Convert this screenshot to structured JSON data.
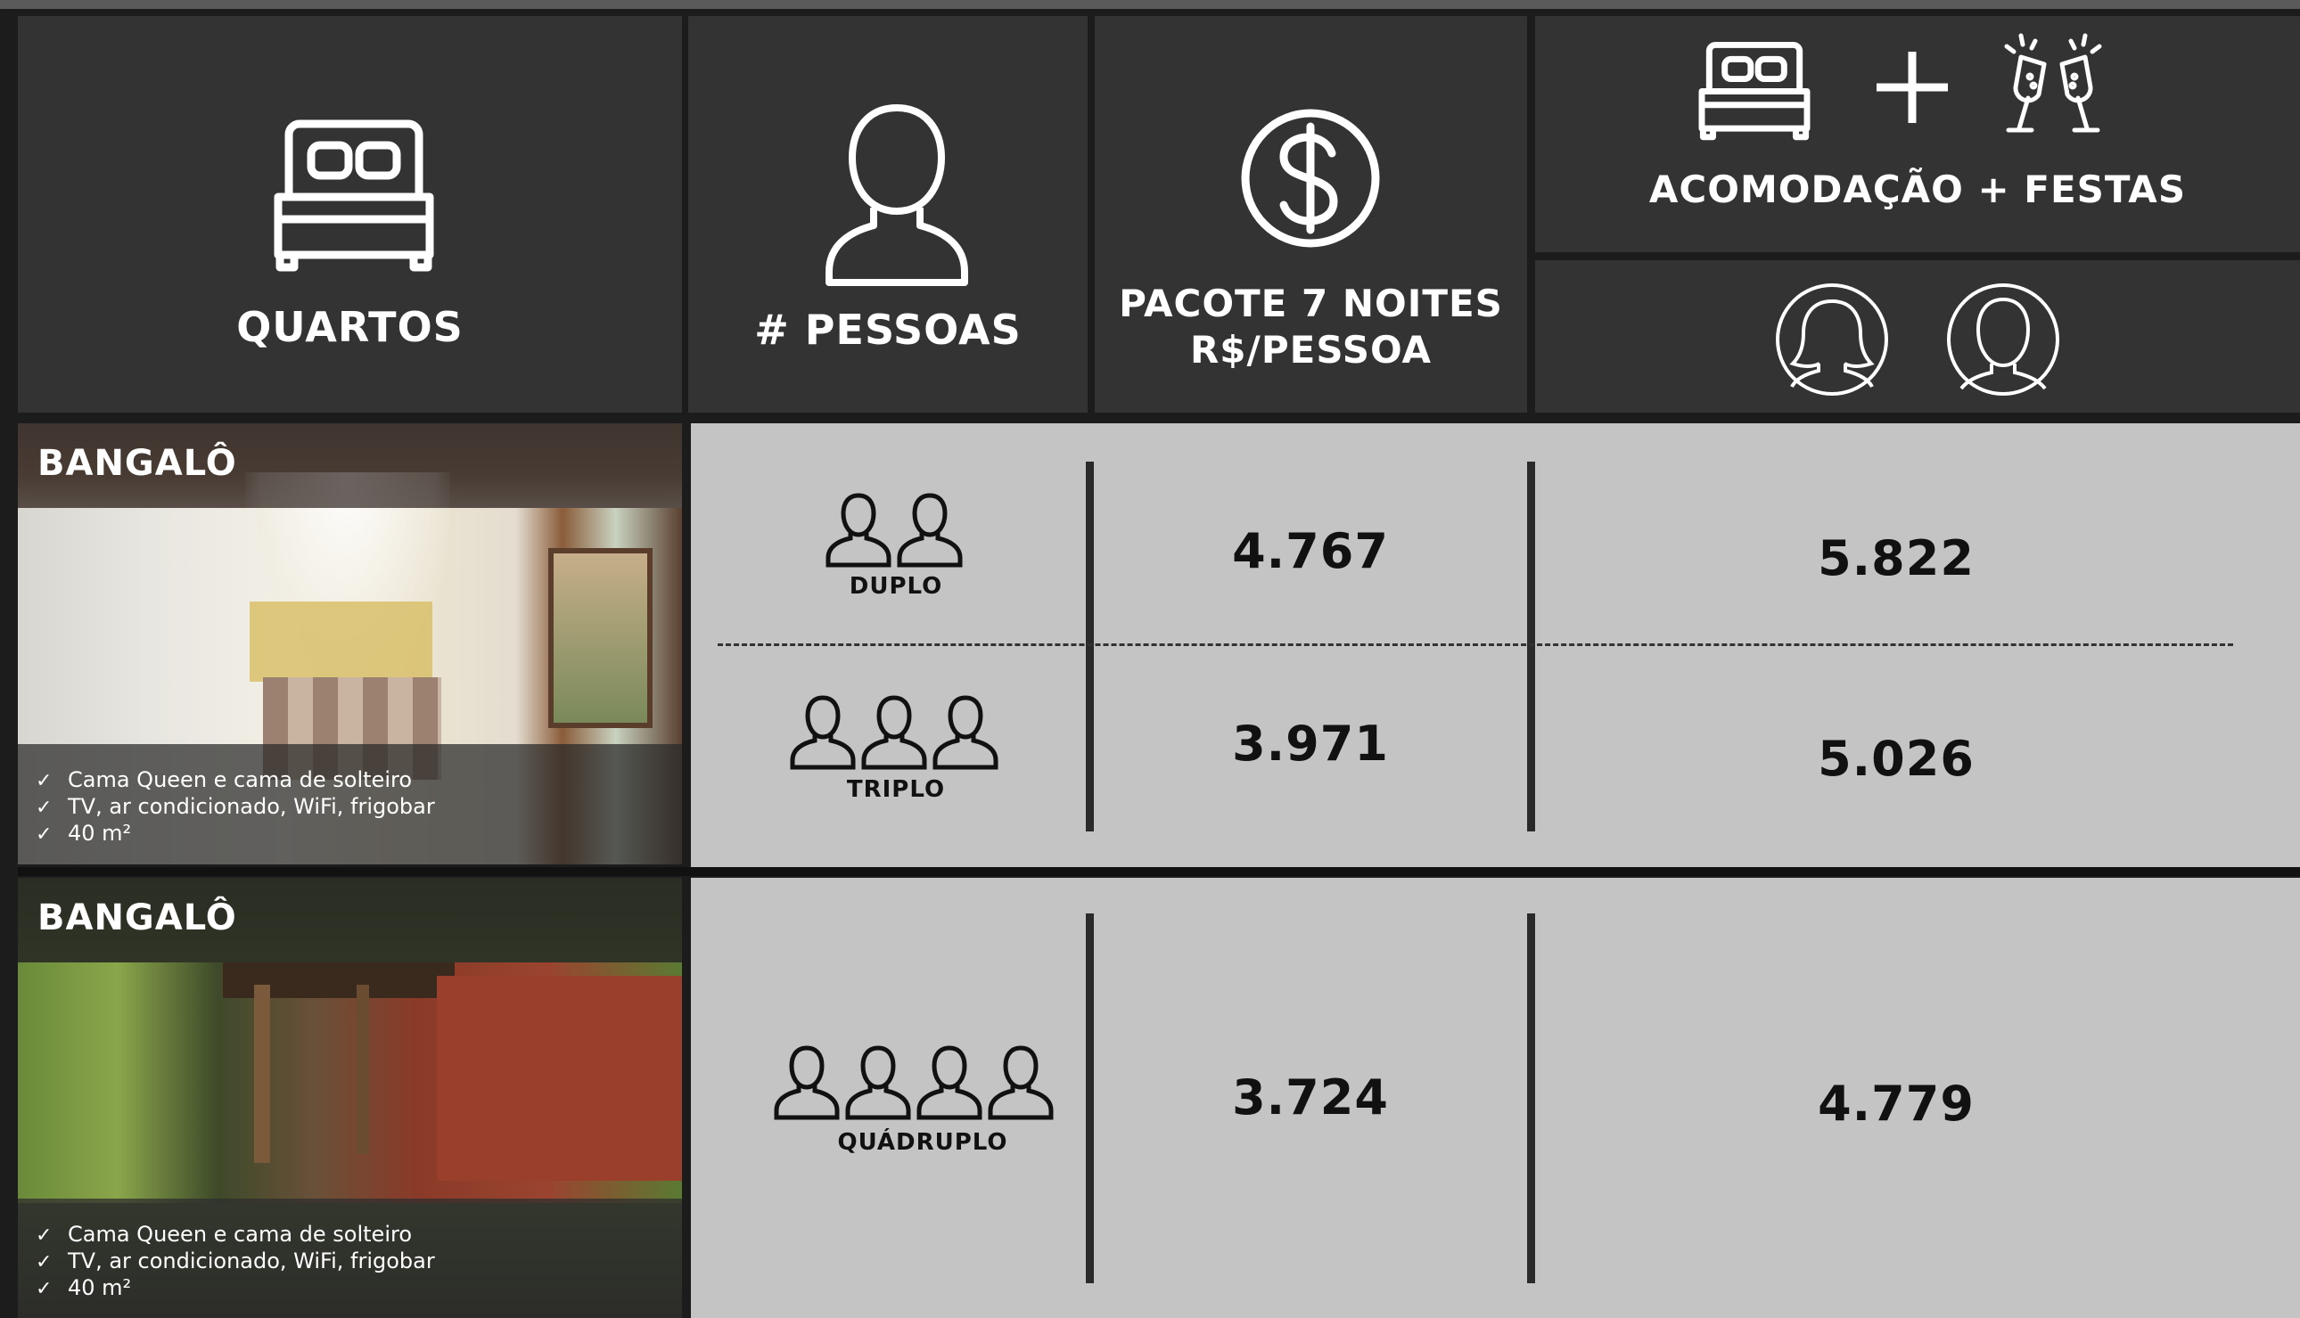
{
  "header": {
    "rooms_label": "QUARTOS",
    "people_label": "# PESSOAS",
    "package_label_line1": "PACOTE 7 NOITES",
    "package_label_line2": "R$/PESSOA",
    "combo_label": "ACOMODAÇÃO + FESTAS",
    "icons": [
      "bed-icon",
      "person-icon",
      "dollar-icon",
      "bed-icon",
      "plus-icon",
      "champagne-icon",
      "woman-icon",
      "man-icon"
    ]
  },
  "rooms": [
    {
      "title": "BANGALÔ",
      "features": [
        "Cama Queen e cama de solteiro",
        "TV, ar condicionado, WiFi, frigobar",
        "40 m²"
      ],
      "options": [
        {
          "occupancy": "DUPLO",
          "people": 2,
          "package_price": "4.767",
          "combo_price": "5.822"
        },
        {
          "occupancy": "TRIPLO",
          "people": 3,
          "package_price": "3.971",
          "combo_price": "5.026"
        }
      ]
    },
    {
      "title": "BANGALÔ",
      "features": [
        "Cama Queen e cama de solteiro",
        "TV, ar condicionado, WiFi, frigobar",
        "40 m²"
      ],
      "options": [
        {
          "occupancy": "QUÁDRUPLO",
          "people": 4,
          "package_price": "3.724",
          "combo_price": "4.779"
        }
      ]
    }
  ],
  "colors": {
    "header_bg": "#333333",
    "row_bg": "#c4c4c4",
    "divider": "#1c1c1c",
    "text_dark": "#111111",
    "text_light": "#ffffff"
  }
}
